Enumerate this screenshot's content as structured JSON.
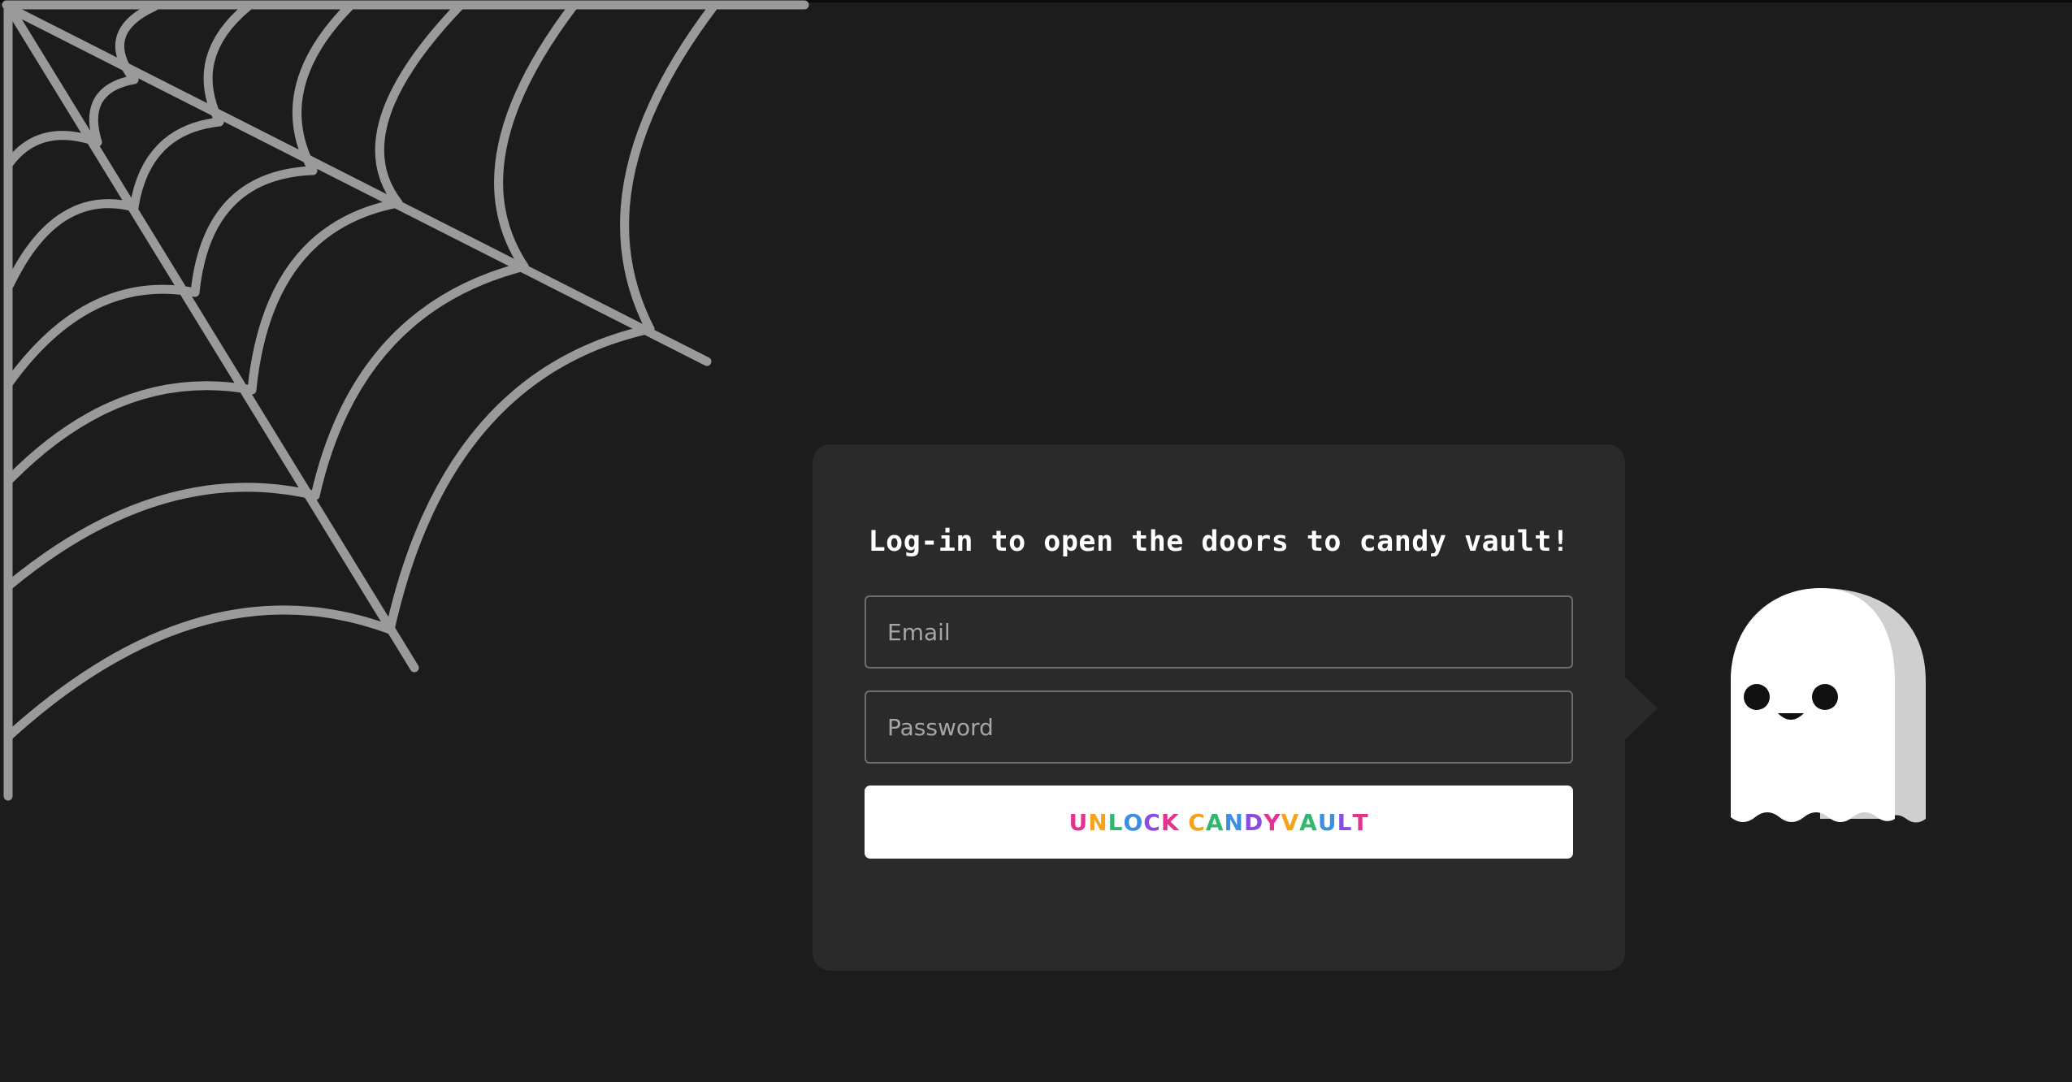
{
  "login": {
    "heading": "Log-in to open the doors to candy vault!",
    "email_placeholder": "Email",
    "password_placeholder": "Password",
    "submit_label": "UNLOCK CANDYVAULT"
  },
  "colors": {
    "background": "#1c1c1c",
    "card": "#2a2a2a",
    "web_stroke": "#9a9a9a",
    "ghost_body": "#ffffff",
    "ghost_shadow": "#cfcfcf",
    "button_letters": [
      "#e3338f",
      "#f5a31a",
      "#30b870",
      "#3d8fe0",
      "#8b4de0",
      "#e3338f",
      "#f5a31a",
      "#30b870",
      "#3d8fe0",
      "#8b4de0",
      "#e3338f",
      "#f5a31a",
      "#30b870",
      "#3d8fe0",
      "#8b4de0",
      "#e3338f",
      "#f5a31a"
    ]
  },
  "icons": {
    "web": "spider-web-icon",
    "ghost": "ghost-icon"
  }
}
